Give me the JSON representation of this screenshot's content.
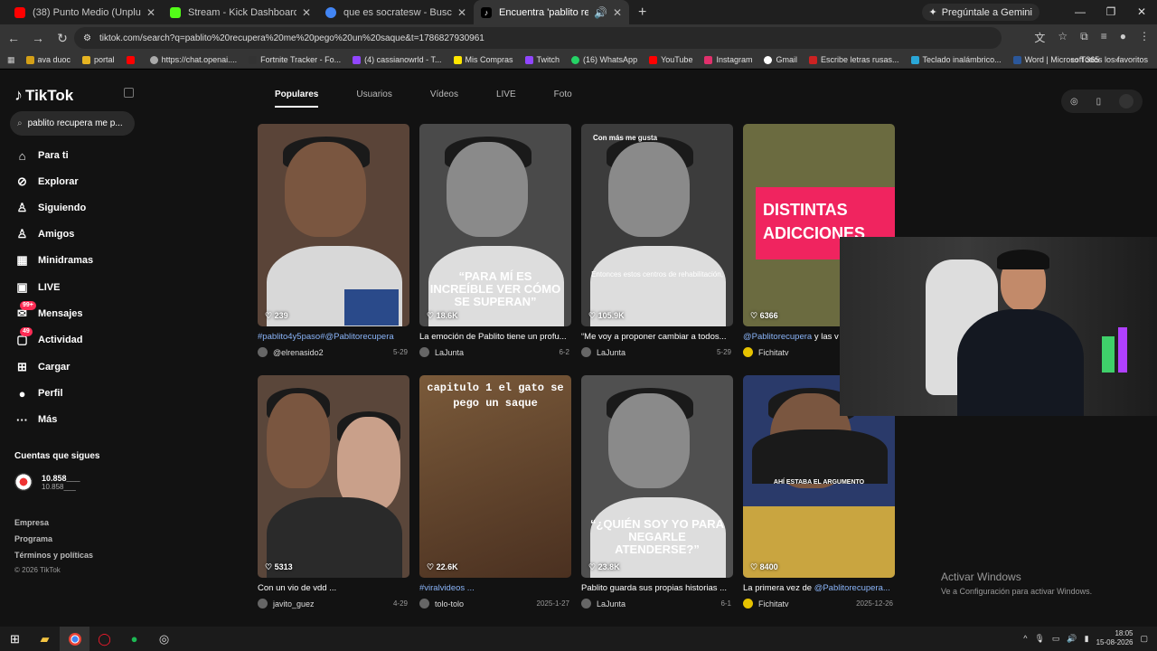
{
  "browser": {
    "tabs": [
      {
        "title": "(38) Punto Medio (Unplugged)",
        "color": "#ff0000"
      },
      {
        "title": "Stream - Kick Dashboard",
        "color": "#53fc18"
      },
      {
        "title": "que es socratesw - Buscar con",
        "color": "#4285f4"
      },
      {
        "title": "Encuentra 'pablito recupera",
        "color": "#ffffff"
      }
    ],
    "gemini_label": "Pregúntale a Gemini",
    "url": "tiktok.com/search?q=pablito%20recupera%20me%20pego%20un%20saque&t=1786827930961",
    "bookmarks": [
      "ava duoc",
      "portal",
      "https://chat.openai....",
      "Fortnite Tracker - Fo...",
      "(4) cassianowrld - T...",
      "Mis Compras",
      "Twitch",
      "(16) WhatsApp",
      "YouTube",
      "Instagram",
      "Gmail",
      "Escribe letras rusas...",
      "Teclado inalámbrico...",
      "Word | Microsoft 365"
    ],
    "bookmarks_right": "Todos los favoritos"
  },
  "tiktok": {
    "logo": "TikTok",
    "search_value": "pablito recupera me p...",
    "nav": [
      {
        "label": "Para ti",
        "icon": "⌂"
      },
      {
        "label": "Explorar",
        "icon": "⊘"
      },
      {
        "label": "Siguiendo",
        "icon": "♙"
      },
      {
        "label": "Amigos",
        "icon": "♙"
      },
      {
        "label": "Minidramas",
        "icon": "▦"
      },
      {
        "label": "LIVE",
        "icon": "▣"
      },
      {
        "label": "Mensajes",
        "icon": "✉",
        "badge": "99+"
      },
      {
        "label": "Actividad",
        "icon": "▢",
        "badge": "49"
      },
      {
        "label": "Cargar",
        "icon": "⊞"
      },
      {
        "label": "Perfil",
        "icon": "●"
      },
      {
        "label": "Más",
        "icon": "···"
      }
    ],
    "following_header": "Cuentas que sigues",
    "following": {
      "name": "10.858___",
      "sub": "10.858___"
    },
    "footer": [
      "Empresa",
      "Programa",
      "Términos y políticas"
    ],
    "copyright": "© 2026 TikTok",
    "search_tabs": [
      "Populares",
      "Usuarios",
      "Vídeos",
      "LIVE",
      "Foto"
    ],
    "videos": [
      {
        "likes": "239",
        "caption_tag": "#pablito4y5paso#@Pablitorecupera",
        "caption": "",
        "author": "@elrenasido2",
        "date": "5-29",
        "overlay": "",
        "bg": "#5a4438"
      },
      {
        "likes": "18.6K",
        "caption_tag": "",
        "caption": "La emoción de Pablito tiene un profu...",
        "author": "LaJunta",
        "date": "6-2",
        "overlay": "“PARA MÍ ES INCREÍBLE VER CÓMO SE SUPERAN”",
        "bg": "#4a4a4a"
      },
      {
        "likes": "105.9K",
        "caption_tag": "",
        "caption": "“Me voy a proponer cambiar a todos...",
        "author": "LaJunta",
        "date": "5-29",
        "overlay": "Entonces estos centros de rehabilitación,",
        "bg": "#3c3c3c",
        "top_label": "Con más me gusta"
      },
      {
        "likes": "6366",
        "caption_tag": "@Pablitorecupera",
        "caption": " y las v",
        "author": "Fichitatv",
        "date": "",
        "overlay": "DISTINTAS ADICCIONES",
        "bg": "#6b6b40"
      },
      {
        "likes": "5313",
        "caption_tag": "",
        "caption": "Con un vio de vdd ...",
        "author": "javito_guez",
        "date": "4-29",
        "overlay": "",
        "bg": "#5a463a"
      },
      {
        "likes": "22.6K",
        "caption_tag": "#viralvideos ...",
        "caption": "",
        "author": "tolo-tolo",
        "date": "2025-1-27",
        "overlay": "capitulo 1 el gato se pego un saque",
        "bg": "#6a4a30"
      },
      {
        "likes": "23.8K",
        "caption_tag": "",
        "caption": "Pablito guarda sus propias historias ...",
        "author": "LaJunta",
        "date": "6-1",
        "overlay": "“¿QUIÉN SOY YO PARA NEGARLE ATENDERSE?”",
        "bg": "#505050"
      },
      {
        "likes": "8400",
        "caption_tag": "@Pablitorecupera...",
        "caption": "La primera vez de ",
        "author": "Fichitatv",
        "date": "2025-12-26",
        "overlay": "AHÍ ESTABA EL ARGUMENTO",
        "bg": "#2a3a6a"
      }
    ]
  },
  "windows": {
    "activate_title": "Activar Windows",
    "activate_sub": "Ve a Configuración para activar Windows.",
    "time": "18:05",
    "date": "15-08-2026"
  }
}
